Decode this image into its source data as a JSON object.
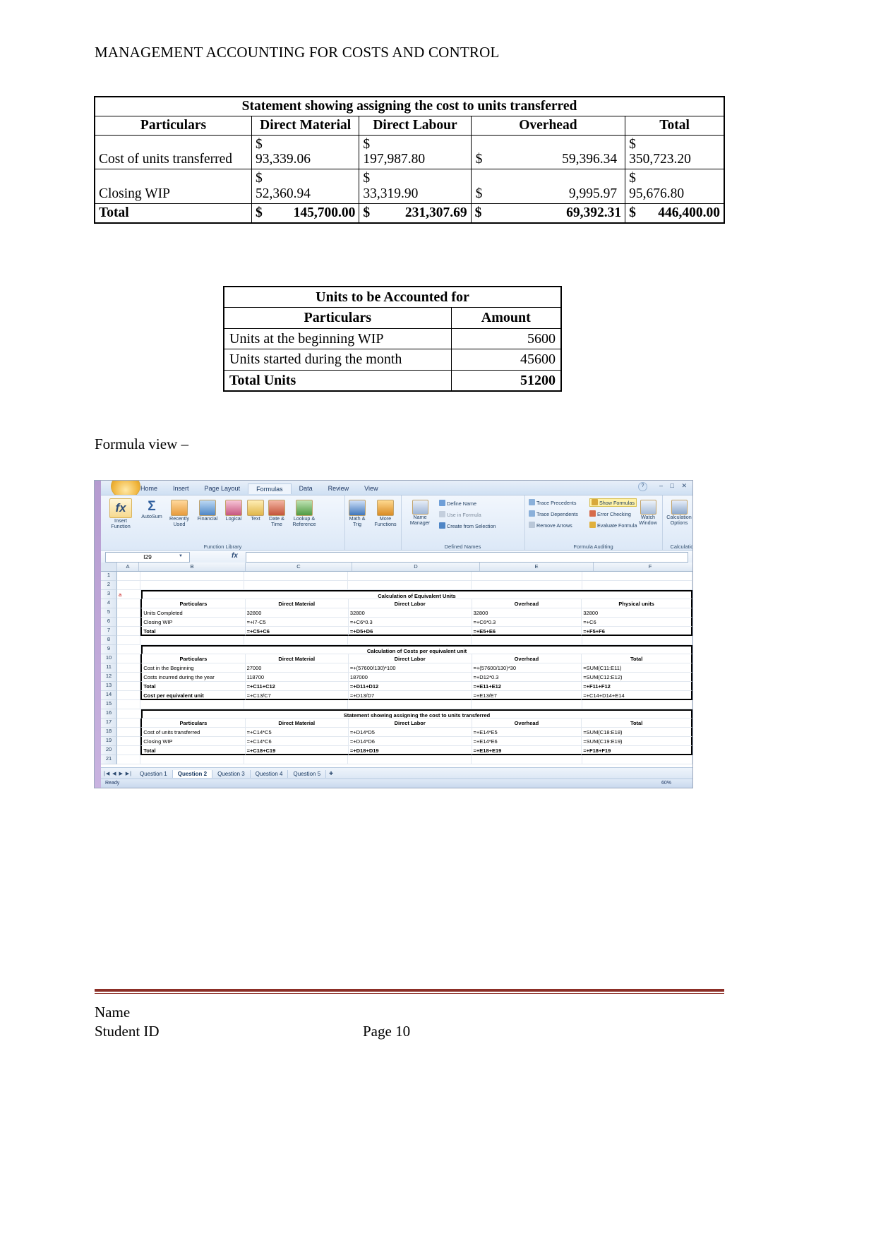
{
  "document": {
    "header_title": "MANAGEMENT ACCOUNTING FOR COSTS AND CONTROL",
    "formula_view_caption": "Formula view –",
    "footer": {
      "name": "Name",
      "student_id": "Student ID",
      "page": "Page 10",
      "rule_color": "#8c2f27"
    }
  },
  "table1": {
    "title": "Statement showing assigning the cost to units transferred",
    "columns": [
      "Particulars",
      "Direct Material",
      "Direct Labour",
      "Overhead",
      "Total"
    ],
    "rows": [
      {
        "label": "Cost of units transferred",
        "direct_material": {
          "symbol": "$",
          "amount": "93,339.06"
        },
        "direct_labour": {
          "symbol": "$",
          "amount": "197,987.80"
        },
        "overhead": {
          "symbol": "$",
          "amount": "59,396.34"
        },
        "total": {
          "symbol": "$",
          "amount": "350,723.20"
        }
      },
      {
        "label": "Closing WIP",
        "direct_material": {
          "symbol": "$",
          "amount": "52,360.94"
        },
        "direct_labour": {
          "symbol": "$",
          "amount": "33,319.90"
        },
        "overhead": {
          "symbol": "$",
          "amount": "9,995.97"
        },
        "total": {
          "symbol": "$",
          "amount": "95,676.80"
        }
      }
    ],
    "total_row": {
      "label": "Total",
      "direct_material": {
        "symbol": "$",
        "amount": "145,700.00"
      },
      "direct_labour": {
        "symbol": "$",
        "amount": "231,307.69"
      },
      "overhead": {
        "symbol": "$",
        "amount": "69,392.31"
      },
      "total": {
        "symbol": "$",
        "amount": "446,400.00"
      }
    }
  },
  "table2": {
    "title": "Units to be Accounted for",
    "columns": [
      "Particulars",
      "Amount"
    ],
    "rows": [
      {
        "label": "Units at the beginning WIP",
        "amount": "5600"
      },
      {
        "label": "Units started during the month",
        "amount": "45600"
      }
    ],
    "total_row": {
      "label": "Total Units",
      "amount": "51200"
    }
  },
  "excel": {
    "window_controls": "– □ ✕",
    "help_icon": "?",
    "ribbon_tabs": [
      {
        "label": "Home",
        "active": false
      },
      {
        "label": "Insert",
        "active": false
      },
      {
        "label": "Page Layout",
        "active": false
      },
      {
        "label": "Formulas",
        "active": true
      },
      {
        "label": "Data",
        "active": false
      },
      {
        "label": "Review",
        "active": false
      },
      {
        "label": "View",
        "active": false
      }
    ],
    "groups": [
      {
        "name": "Function Library"
      },
      {
        "name": "Defined Names"
      },
      {
        "name": "Formula Auditing"
      },
      {
        "name": "Calculation"
      }
    ],
    "function_library": [
      {
        "label": "Insert Function",
        "icon": "fx-icon"
      },
      {
        "label": "AutoSum",
        "icon": "sigma-icon"
      },
      {
        "label": "Recently Used",
        "icon": "recent-icon"
      },
      {
        "label": "Financial",
        "icon": "financial-icon"
      },
      {
        "label": "Logical",
        "icon": "logical-icon"
      },
      {
        "label": "Text",
        "icon": "text-icon"
      },
      {
        "label": "Date & Time",
        "icon": "date-time-icon"
      },
      {
        "label": "Lookup & Reference",
        "icon": "lookup-icon"
      },
      {
        "label": "Math & Trig",
        "icon": "math-icon"
      },
      {
        "label": "More Functions",
        "icon": "more-functions-icon"
      }
    ],
    "defined_names": [
      {
        "label": "Name Manager",
        "icon": "name-manager-icon"
      },
      {
        "label": "Define Name",
        "icon": "define-name-icon"
      },
      {
        "label": "Use in Formula",
        "icon": "use-in-formula-icon"
      },
      {
        "label": "Create from Selection",
        "icon": "create-from-selection-icon"
      }
    ],
    "formula_auditing": [
      {
        "label": "Trace Precedents",
        "icon": "trace-precedents-icon"
      },
      {
        "label": "Trace Dependents",
        "icon": "trace-dependents-icon"
      },
      {
        "label": "Remove Arrows",
        "icon": "remove-arrows-icon"
      },
      {
        "label": "Show Formulas",
        "icon": "show-formulas-icon",
        "highlighted": true
      },
      {
        "label": "Error Checking",
        "icon": "error-checking-icon"
      },
      {
        "label": "Evaluate Formula",
        "icon": "evaluate-formula-icon"
      },
      {
        "label": "Watch Window",
        "icon": "watch-window-icon"
      }
    ],
    "calculation": [
      {
        "label": "Calculation Options",
        "icon": "calculation-options-icon"
      }
    ],
    "name_box_value": "I29",
    "formula_bar_value": "",
    "column_headers": [
      "A",
      "B",
      "C",
      "D",
      "E",
      "F"
    ],
    "grid": {
      "block1_title": "Calculation of Equivalent Units",
      "block1_headers": [
        "Particulars",
        "Direct Material",
        "Direct Labor",
        "Overhead",
        "Physical units"
      ],
      "block1_rows": [
        {
          "row": "5",
          "cells": [
            "Units Completed",
            "32800",
            "32800",
            "32800",
            "32800"
          ]
        },
        {
          "row": "6",
          "cells": [
            "Closing WIP",
            "=+I7-C5",
            "=+C6*0.3",
            "=+C6*0.3",
            "=+C6"
          ]
        },
        {
          "row": "7",
          "cells": [
            "Total",
            "=+C5+C6",
            "=+D5+D6",
            "=+E5+E6",
            "=+F5+F6"
          ]
        }
      ],
      "block2_title": "Calculation of Costs per equivalent unit",
      "block2_headers": [
        "Particulars",
        "Direct Material",
        "Direct Labor",
        "Overhead",
        "Total"
      ],
      "block2_rows": [
        {
          "row": "11",
          "cells": [
            "Cost in the Beginning",
            "27000",
            "=+(57600/130)*100",
            "=+(57600/130)*30",
            "=SUM(C11:E11)"
          ]
        },
        {
          "row": "12",
          "cells": [
            "Costs incurred during the year",
            "118700",
            "187000",
            "=+D12*0.3",
            "=SUM(C12:E12)"
          ]
        },
        {
          "row": "13",
          "cells": [
            "Total",
            "=+C11+C12",
            "=+D11+D12",
            "=+E11+E12",
            "=+F11+F12"
          ]
        },
        {
          "row": "14",
          "cells": [
            "Cost per equivalent unit",
            "=+C13/C7",
            "=+D13/D7",
            "=+E13/E7",
            "=+C14+D14+E14"
          ]
        }
      ],
      "block3_title": "Statement showing assigning the cost to units transferred",
      "block3_headers": [
        "Particulars",
        "Direct Material",
        "Direct Labor",
        "Overhead",
        "Total"
      ],
      "block3_rows": [
        {
          "row": "18",
          "cells": [
            "Cost of units transferred",
            "=+C14*C5",
            "=+D14*D5",
            "=+E14*E5",
            "=SUM(C18:E18)"
          ]
        },
        {
          "row": "19",
          "cells": [
            "Closing WIP",
            "=+C14*C6",
            "=+D14*D6",
            "=+E14*E6",
            "=SUM(C19:E19)"
          ]
        },
        {
          "row": "20",
          "cells": [
            "Total",
            "=+C18+C19",
            "=+D18+D19",
            "=+E18+E19",
            "=+F18+F19"
          ]
        }
      ],
      "empty_rows": [
        "1",
        "2",
        "3",
        "4",
        "8",
        "9",
        "10",
        "15",
        "16",
        "17",
        "21"
      ],
      "marker_cell_a3": "a"
    },
    "sheet_tabs": [
      {
        "label": "Question 1",
        "active": false
      },
      {
        "label": "Question 2",
        "active": true
      },
      {
        "label": "Question 3",
        "active": false
      },
      {
        "label": "Question 4",
        "active": false
      },
      {
        "label": "Question 5",
        "active": false
      }
    ],
    "status_text": "Ready",
    "zoom_level": "60%"
  }
}
